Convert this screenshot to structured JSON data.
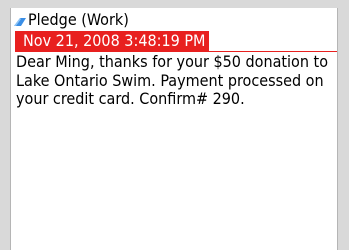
{
  "message": {
    "subject": "Pledge (Work)",
    "subject_icon": "message-icon",
    "timestamp": "Nov 21, 2008 3:48:19 PM",
    "body": "Dear Ming, thanks for your $50 donation to Lake Ontario Swim. Payment processed on your credit card. Confirm# 290."
  },
  "colors": {
    "highlight": "#e8201f",
    "icon": "#3a8ee6"
  }
}
